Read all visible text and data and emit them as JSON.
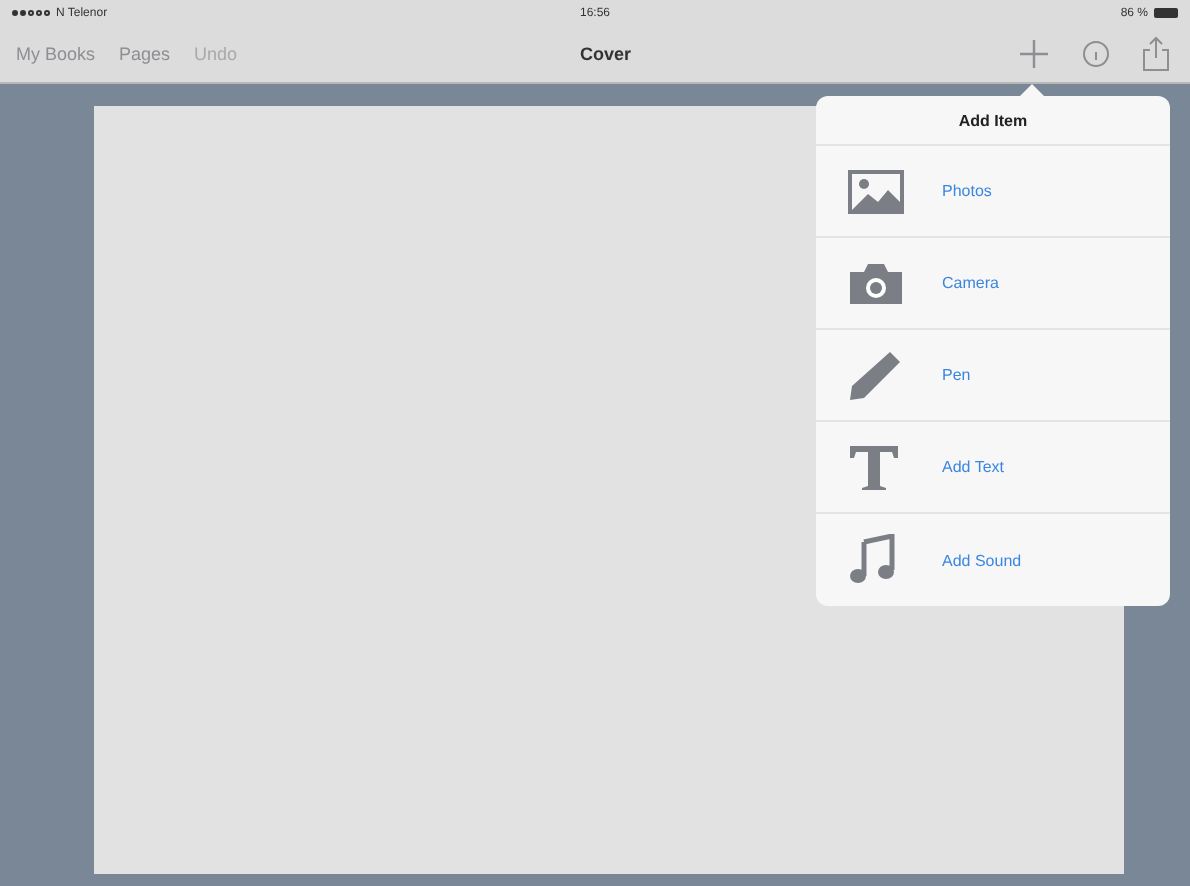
{
  "status_bar": {
    "carrier": "N Telenor",
    "time": "16:56",
    "battery": "86 %"
  },
  "nav_bar": {
    "left_items": [
      {
        "label": "My Books",
        "disabled": false
      },
      {
        "label": "Pages",
        "disabled": false
      },
      {
        "label": "Undo",
        "disabled": true
      }
    ],
    "title": "Cover"
  },
  "popover": {
    "title": "Add Item",
    "items": [
      {
        "kind": "photos",
        "label": "Photos"
      },
      {
        "kind": "camera",
        "label": "Camera"
      },
      {
        "kind": "pen",
        "label": "Pen"
      },
      {
        "kind": "text",
        "label": "Add Text"
      },
      {
        "kind": "sound",
        "label": "Add Sound"
      }
    ]
  }
}
